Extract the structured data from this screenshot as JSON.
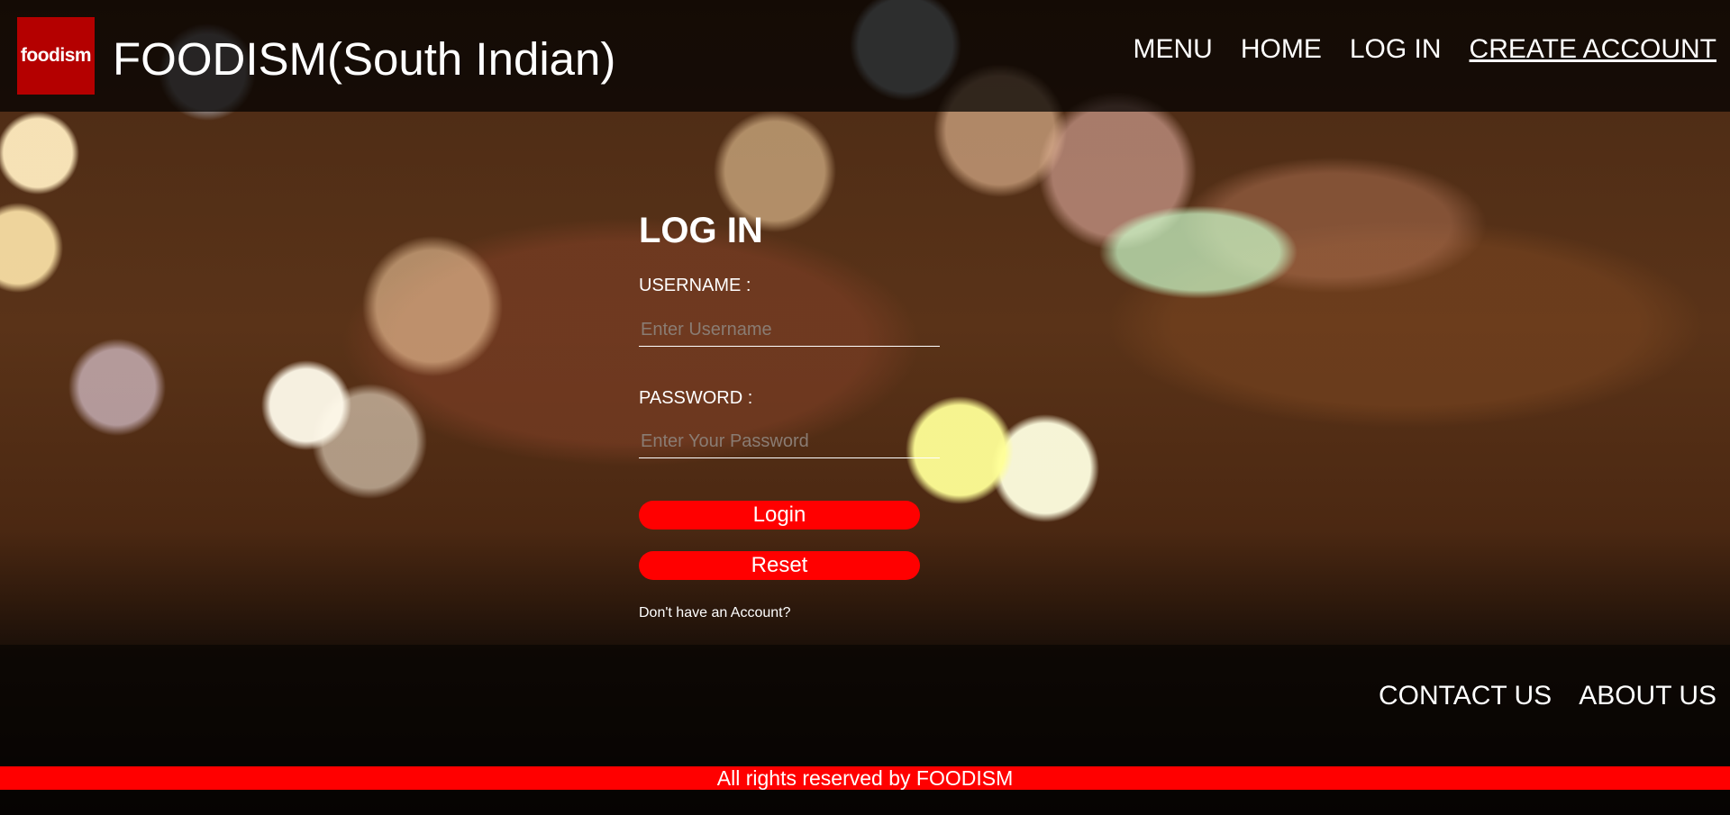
{
  "header": {
    "logo_text": "foodism",
    "title": "FOODISM(South Indian)",
    "nav": [
      {
        "label": "MENU"
      },
      {
        "label": "HOME"
      },
      {
        "label": "LOG IN"
      },
      {
        "label": "CREATE ACCOUNT"
      }
    ]
  },
  "login_form": {
    "title": "LOG IN",
    "username_label": "USERNAME :",
    "username_placeholder": "Enter Username",
    "username_value": "",
    "password_label": "PASSWORD :",
    "password_placeholder": "Enter Your Password",
    "password_value": "",
    "login_button": "Login",
    "reset_button": "Reset",
    "signup_prompt": "Don't have an Account?"
  },
  "footer": {
    "links": [
      {
        "label": "CONTACT US"
      },
      {
        "label": "ABOUT US"
      }
    ],
    "copyright": "All rights reserved by FOODISM"
  },
  "colors": {
    "accent": "#ff0000",
    "logo_bg": "#b40000",
    "header_bg": "#000000"
  }
}
